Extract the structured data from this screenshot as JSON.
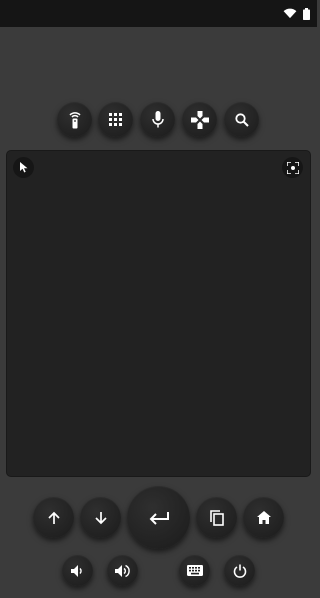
{
  "status_bar": {
    "icons": [
      "wifi-icon",
      "battery-icon"
    ],
    "background": "#151515"
  },
  "top_toolbar": {
    "buttons": [
      {
        "name": "remote-button",
        "icon": "remote-control-icon"
      },
      {
        "name": "apps-button",
        "icon": "apps-grid-icon"
      },
      {
        "name": "voice-button",
        "icon": "microphone-icon"
      },
      {
        "name": "gamepad-button",
        "icon": "gamepad-icon"
      },
      {
        "name": "search-button",
        "icon": "search-icon"
      }
    ]
  },
  "touchpad": {
    "icons": [
      "mouse-pointer-icon",
      "fullscreen-icon"
    ],
    "background": "#222222"
  },
  "navigation": {
    "buttons": [
      {
        "name": "up-button",
        "icon": "arrow-up-icon"
      },
      {
        "name": "down-button",
        "icon": "arrow-down-icon"
      },
      {
        "name": "enter-button",
        "icon": "enter-icon"
      },
      {
        "name": "copy-button",
        "icon": "copy-icon"
      },
      {
        "name": "home-button",
        "icon": "home-icon"
      }
    ]
  },
  "bottom_row": {
    "buttons": [
      {
        "name": "volume-down-button",
        "icon": "volume-down-icon"
      },
      {
        "name": "volume-up-button",
        "icon": "volume-up-icon"
      },
      {
        "name": "keyboard-button",
        "icon": "keyboard-icon"
      },
      {
        "name": "power-button",
        "icon": "power-icon"
      }
    ]
  },
  "colors": {
    "background": "#3b3b3b",
    "button": "#232323",
    "icon": "#ffffff"
  }
}
